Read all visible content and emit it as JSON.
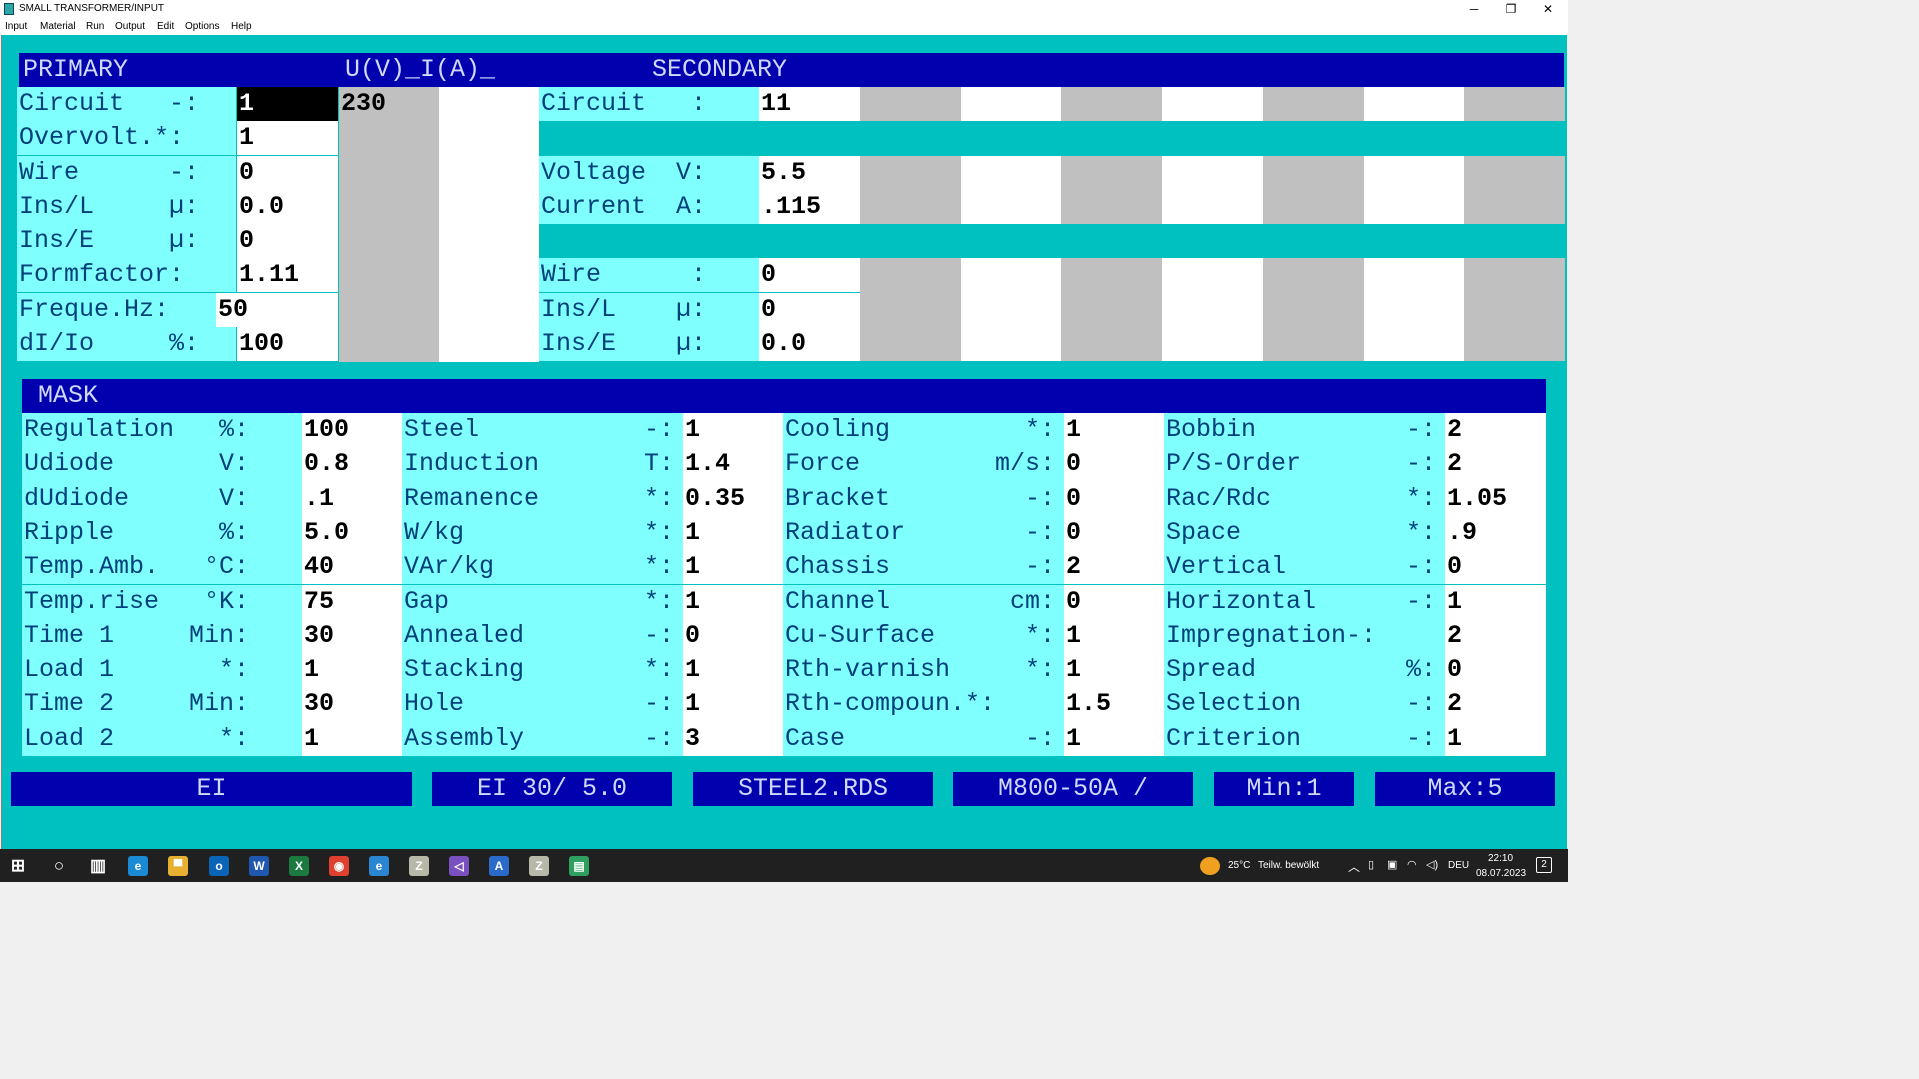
{
  "window": {
    "title": "SMALL TRANSFORMER/INPUT",
    "min": "─",
    "restore": "❐",
    "close": "✕"
  },
  "menu": [
    "Input",
    "Material",
    "Run",
    "Output",
    "Edit",
    "Options",
    "Help"
  ],
  "primary": {
    "title": "PRIMARY",
    "uvia": "U(V)_I(A)_",
    "circuit_value2": "230",
    "rows": [
      {
        "label": "Circuit   -:",
        "value": "1"
      },
      {
        "label": "Overvolt.*:",
        "value": "1"
      },
      {
        "label": "Wire      -:",
        "value": "0"
      },
      {
        "label": "Ins/L     µ:",
        "value": "0.0"
      },
      {
        "label": "Ins/E     µ:",
        "value": "0"
      },
      {
        "label": "Formfactor:",
        "value": "1.11"
      },
      {
        "label": "Freque.Hz:",
        "value": "50"
      },
      {
        "label": "dI/Io     %:",
        "value": "100"
      }
    ]
  },
  "secondary": {
    "title": "SECONDARY",
    "rows": [
      {
        "label": "Circuit   :",
        "value": "11"
      },
      {
        "label": "",
        "value": ""
      },
      {
        "label": "Voltage  V:",
        "value": "5.5"
      },
      {
        "label": "Current  A:",
        "value": ".115"
      },
      {
        "label": "",
        "value": ""
      },
      {
        "label": "Wire      :",
        "value": "0"
      },
      {
        "label": "Ins/L    µ:",
        "value": "0"
      },
      {
        "label": "Ins/E    µ:",
        "value": "0.0"
      }
    ]
  },
  "mask": {
    "title": "MASK",
    "columns": [
      [
        {
          "label": "Regulation   %:",
          "value": "100"
        },
        {
          "label": "Udiode       V:",
          "value": "0.8"
        },
        {
          "label": "dUdiode      V:",
          "value": ".1"
        },
        {
          "label": "Ripple       %:",
          "value": "5.0"
        },
        {
          "label": "Temp.Amb.   °C:",
          "value": "40"
        },
        {
          "label": "Temp.rise   °K:",
          "value": "75"
        },
        {
          "label": "Time 1     Min:",
          "value": "30"
        },
        {
          "label": "Load 1       *:",
          "value": "1"
        },
        {
          "label": "Time 2     Min:",
          "value": "30"
        },
        {
          "label": "Load 2       *:",
          "value": "1"
        }
      ],
      [
        {
          "label": "Steel           -:",
          "value": "1"
        },
        {
          "label": "Induction       T:",
          "value": "1.4"
        },
        {
          "label": "Remanence       *:",
          "value": "0.35"
        },
        {
          "label": "W/kg            *:",
          "value": "1"
        },
        {
          "label": "VAr/kg          *:",
          "value": "1"
        },
        {
          "label": "Gap             *:",
          "value": "1"
        },
        {
          "label": "Annealed        -:",
          "value": "0"
        },
        {
          "label": "Stacking        *:",
          "value": "1"
        },
        {
          "label": "Hole            -:",
          "value": "1"
        },
        {
          "label": "Assembly        -:",
          "value": "3"
        }
      ],
      [
        {
          "label": "Cooling         *:",
          "value": "1"
        },
        {
          "label": "Force         m/s:",
          "value": "0"
        },
        {
          "label": "Bracket         -:",
          "value": "0"
        },
        {
          "label": "Radiator        -:",
          "value": "0"
        },
        {
          "label": "Chassis         -:",
          "value": "2"
        },
        {
          "label": "Channel        cm:",
          "value": "0"
        },
        {
          "label": "Cu-Surface      *:",
          "value": "1"
        },
        {
          "label": "Rth-varnish     *:",
          "value": "1"
        },
        {
          "label": "Rth-compoun.*:",
          "value": "1.5"
        },
        {
          "label": "Case            -:",
          "value": "1"
        }
      ],
      [
        {
          "label": "Bobbin          -:",
          "value": "2"
        },
        {
          "label": "P/S-Order       -:",
          "value": "2"
        },
        {
          "label": "Rac/Rdc         *:",
          "value": "1.05"
        },
        {
          "label": "Space           *:",
          "value": ".9"
        },
        {
          "label": "Vertical        -:",
          "value": "0"
        },
        {
          "label": "Horizontal      -:",
          "value": "1"
        },
        {
          "label": "Impregnation-:",
          "value": "2"
        },
        {
          "label": "Spread          %:",
          "value": "0"
        },
        {
          "label": "Selection       -:",
          "value": "2"
        },
        {
          "label": "Criterion       -:",
          "value": "1"
        }
      ]
    ]
  },
  "bottom_buttons": [
    "EI",
    "EI 30/ 5.0",
    "STEEL2.RDS",
    "M800-50A /",
    "Min:1",
    "Max:5"
  ],
  "taskbar": {
    "weather_temp": "25°C",
    "weather_text": "Teilw. bewölkt",
    "lang": "DEU",
    "time": "22:10",
    "date": "08.07.2023",
    "notifications": "2",
    "icons": [
      "windows-start",
      "search",
      "task-view",
      "edge",
      "file-explorer",
      "outlook",
      "word",
      "excel",
      "chrome",
      "internet-explorer",
      "z-app",
      "visual-studio",
      "a-app",
      "z-app-2",
      "calculator-app"
    ]
  },
  "colors": {
    "client_bg": "#00c0c0",
    "header_bg": "#0000ae",
    "label_bg": "#80ffff",
    "label_text": "#00407a",
    "field_bg": "#ffffff",
    "grid_gray": "#c0c0c0",
    "cursor_bg": "#000000"
  }
}
